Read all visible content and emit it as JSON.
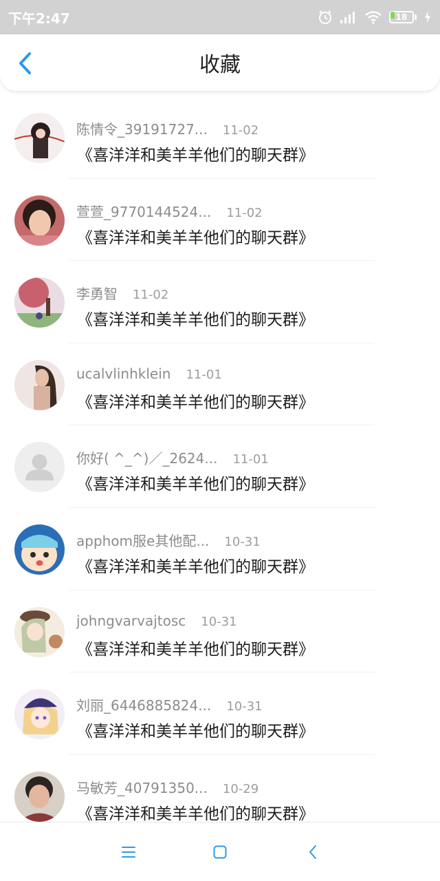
{
  "status_bar": {
    "time": "下午2:47",
    "battery_level": "18",
    "icons": [
      "alarm-icon",
      "signal-icon",
      "wifi-icon",
      "battery-icon",
      "charging-icon"
    ]
  },
  "header": {
    "title": "收藏",
    "back_icon": "chevron-left-icon",
    "accent_color": "#2b9ae6"
  },
  "items": [
    {
      "name": "陈情令_39191727...",
      "date": "11-02",
      "title": "《喜洋洋和美羊羊他们的聊天群》",
      "avatar": "anime-character-avatar"
    },
    {
      "name": "萱萱_9770144524...",
      "date": "11-02",
      "title": "《喜洋洋和美羊羊他们的聊天群》",
      "avatar": "child-photo-avatar"
    },
    {
      "name": "李勇智",
      "date": "11-02",
      "title": "《喜洋洋和美羊羊他们的聊天群》",
      "avatar": "landscape-avatar"
    },
    {
      "name": "ucalvlinhklein",
      "date": "11-01",
      "title": "《喜洋洋和美羊羊他们的聊天群》",
      "avatar": "portrait-avatar"
    },
    {
      "name": "你好( ^_^)／_2624...",
      "date": "11-01",
      "title": "《喜洋洋和美羊羊他们的聊天群》",
      "avatar": "default-user-avatar"
    },
    {
      "name": "apphom服e其他配...",
      "date": "10-31",
      "title": "《喜洋洋和美羊羊他们的聊天群》",
      "avatar": "cartoon-avatar"
    },
    {
      "name": "johngvarvajtosc",
      "date": "10-31",
      "title": "《喜洋洋和美羊羊他们的聊天群》",
      "avatar": "anime-girl-avatar"
    },
    {
      "name": "刘丽_6446885824...",
      "date": "10-31",
      "title": "《喜洋洋和美羊羊他们的聊天群》",
      "avatar": "anime-girl-cap-avatar"
    },
    {
      "name": "马敏芳_40791350...",
      "date": "10-29",
      "title": "《喜洋洋和美羊羊他们的聊天群》",
      "avatar": "elder-photo-avatar"
    }
  ],
  "nav_bar": {
    "buttons": [
      "menu-icon",
      "home-icon",
      "back-icon"
    ],
    "color": "#2b9ae6"
  }
}
